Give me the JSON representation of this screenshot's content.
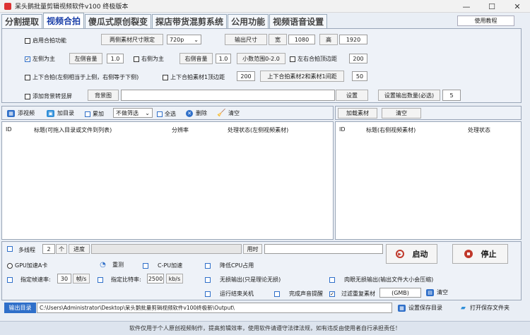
{
  "window": {
    "title": "呆头鹅批量剪辑视频软件v100 终极版本",
    "minimize": "—",
    "maximize": "☐",
    "close": "✕"
  },
  "tabs": [
    "分割提取",
    "视频合拍",
    "傻瓜式原创裂变",
    "探店带货混剪系统",
    "公用功能",
    "视频语音设置"
  ],
  "help_label": "使用教程",
  "settings": {
    "enable_label": "启用合拍功能",
    "size_limit_btn": "两侧素材尺寸限定",
    "resolution": "720p",
    "output_size_btn": "输出尺寸",
    "width_label": "宽",
    "width_value": "1080",
    "height_label": "高",
    "height_value": "1920",
    "left_main_label": "左侧为主",
    "left_main_check": "✓",
    "left_vol_btn": "左侧音量",
    "left_vol_value": "1.0",
    "right_main_label": "右侧为主",
    "right_vol_btn": "右侧音量",
    "right_vol_value": "1.0",
    "decimal_range_btn": "小数范围0-2.0",
    "lr_top_margin_label": "左右合拍顶边距",
    "lr_top_margin_value": "200",
    "updown_label": "上下合拍(左侧相当于上侧，右侧等于下侧)",
    "updown_top_label": "上下合拍素材1顶边距",
    "updown_top_value": "200",
    "updown_gap_btn": "上下合拍素材2和素材1间距",
    "updown_gap_value": "50",
    "bg_label": "添加背景转竖屏",
    "bg_btn": "背景图",
    "bg_path": "",
    "set_btn": "设置",
    "output_count_btn": "设置输出数量(必选)",
    "output_count_value": "5"
  },
  "toolbar": {
    "add_video": "添视频",
    "add_dir": "加目录",
    "stack": "累加",
    "filter": "不做筛选",
    "select_all": "全选",
    "delete": "删除",
    "clear": "清空"
  },
  "right_toolbar": {
    "load": "加载素材",
    "clear": "清空"
  },
  "left_table": {
    "columns": [
      "ID",
      "标题(可拖入目录或文件到列表)",
      "分辨率",
      "处理状态(左侧视频素材)"
    ]
  },
  "right_table": {
    "columns": [
      "ID",
      "标题(右侧视频素材)",
      "处理状态"
    ]
  },
  "bottom": {
    "multithread_label": "多线程",
    "thread_value": "2",
    "thread_unit": "个",
    "progress_label": "进度",
    "time_label": "用时",
    "gpu_label": "GPU加速A卡",
    "recheck_label": "重测",
    "cpu_label": "C-PU加速",
    "reduce_cpu_label": "降低CPU占用",
    "fps_label": "指定帧速率:",
    "fps_value": "30",
    "fps_unit": "帧/s",
    "bitrate_label": "指定比特率:",
    "bitrate_value": "2500",
    "bitrate_unit": "kb/s",
    "lossless_label": "无损输出(只是理论无损)",
    "visual_lossless_label": "肉眼无损输出(输出文件大小会压缩)",
    "shutdown_label": "运行结束关机",
    "sound_label": "完成声音提醒",
    "dedupe_label": "过滤重复素材",
    "dedupe_check": "✓",
    "gmb_value": "(GMB)",
    "dedupe_clear": "清空",
    "start_label": "启动",
    "stop_label": "停止",
    "output_dir_label": "输出目录",
    "output_dir_value": "C:\\Users\\Administrator\\Desktop\\呆头鹅批量剪辑视频软件v100终极新\\Output\\",
    "save_dir_btn": "设置保存目录",
    "open_dir_btn": "打开保存文件夹"
  },
  "footer_text": "软件仅用于个人原创视频制作，提高剪辑效率，使用软件请遵守法律法规，如有违反由使用者自行承担责任！",
  "colors": {
    "accent": "#1a3fa8",
    "start": "#c0392b",
    "stop": "#c0392b"
  }
}
